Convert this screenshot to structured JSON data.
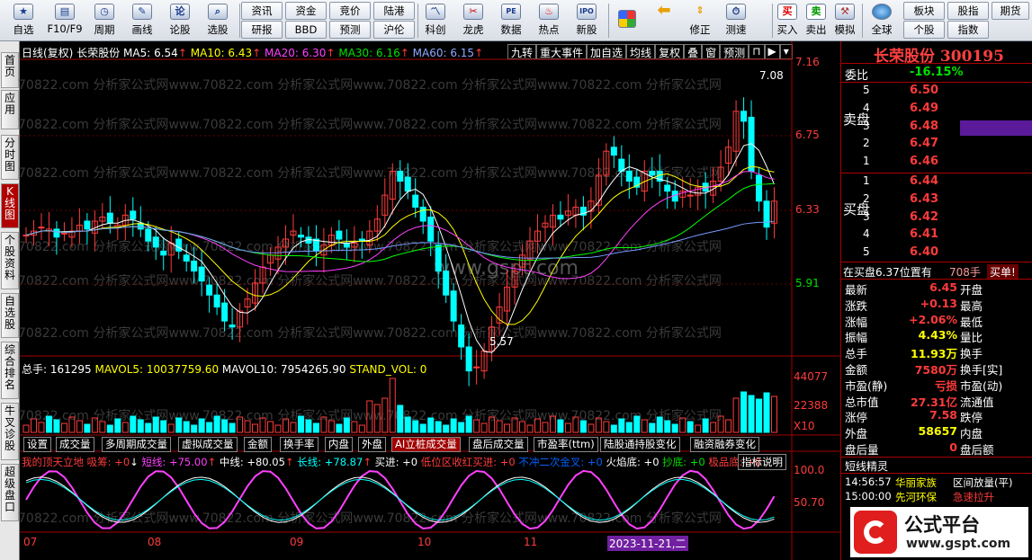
{
  "toolbar": {
    "buttons": [
      "自选",
      "F10/F9",
      "周期",
      "画线",
      "论股",
      "选股",
      "资讯",
      "资金",
      "竞价",
      "陆港",
      "研报",
      "BBD",
      "预测",
      "沪伦",
      "科创",
      "龙虎",
      "数据",
      "热点",
      "新股",
      "买入",
      "卖出",
      "模拟",
      "全球",
      "板块",
      "股指",
      "期货",
      "个股",
      "指数"
    ],
    "icons": [
      "star-icon",
      "f10-icon",
      "clock-icon",
      "pen-icon",
      "discuss-icon",
      "magnifier-icon",
      "news",
      "fund",
      "auction",
      "hk-connect",
      "report",
      "bbd",
      "forecast",
      "shanghai-london",
      "star-market-icon",
      "dragon-tiger-icon",
      "pe-data-icon",
      "hot-icon",
      "ipo-icon"
    ],
    "nav": [
      "修正",
      "测速"
    ]
  },
  "leftnav": [
    "首页",
    "应用",
    "分时图",
    "K线图",
    "个股资料",
    "自选股",
    "综合排名",
    "牛叉诊股",
    "超级盘口"
  ],
  "chart_header": {
    "period": "日线(复权)",
    "stock": "长荣股份",
    "ma5": "MA5: 6.54",
    "ma10": "MA10: 6.43",
    "ma20": "MA20: 6.30",
    "ma30": "MA30: 6.16",
    "ma60": "MA60: 6.15"
  },
  "chart_buttons": [
    "九转",
    "重大事件",
    "加自选",
    "均线",
    "复权",
    "叠",
    "窗",
    "预测"
  ],
  "price_axis": [
    "7.16",
    "6.75",
    "6.33",
    "5.91"
  ],
  "max_label": "7.08",
  "min_label": "5.57",
  "watermarks": {
    "text": "70822.com 分析家公式网www.70822.com 分析家公式网www.70822.com 分析家公式网www.70822.com 分析家公式网",
    "center": "www.gspt.com"
  },
  "volume_header": {
    "total": "总手: 161295",
    "mavol5": "MAVOL5: 10037759.60",
    "mavol10": "MAVOL10: 7954265.90",
    "stand": "STAND_VOL: 0"
  },
  "volume_axis": [
    "44077",
    "22388",
    "X10"
  ],
  "tabs": [
    "设置",
    "成交量",
    "多周期成交量",
    "虚拟成交量",
    "金额",
    "换手率",
    "内盘",
    "外盘",
    "AI立桩成交量",
    "盘后成交量",
    "市盈率(ttm)",
    "陆股通持股变化",
    "融资融券变化"
  ],
  "indicator_header": {
    "a": "我的顶天立地 吸筹: +0",
    "b": "短线: +75.00",
    "c": "中线: +80.05",
    "d": "长线: +78.87",
    "e": "买进: +0",
    "f": "低位区收红买进: +0",
    "g": "不冲二次金叉: +0",
    "h": "火焰底: +0",
    "i": "抄底: +0",
    "j": "极品底: +0",
    "btn": "指标说明"
  },
  "indicator_axis": [
    "100.0",
    "50.70"
  ],
  "date_axis": [
    "07",
    "08",
    "09",
    "10",
    "11"
  ],
  "cursor_date": "2023-11-21,二",
  "right": {
    "title": "长荣股份",
    "code": "300195",
    "weibi_label": "委比",
    "weibi": "-16.15%",
    "sell_label": "卖盘",
    "buy_label": "买盘",
    "sell": [
      {
        "n": "5",
        "p": "6.50"
      },
      {
        "n": "4",
        "p": "6.49"
      },
      {
        "n": "3",
        "p": "6.48"
      },
      {
        "n": "2",
        "p": "6.47"
      },
      {
        "n": "1",
        "p": "6.46"
      }
    ],
    "buy": [
      {
        "n": "1",
        "p": "6.44"
      },
      {
        "n": "2",
        "p": "6.43"
      },
      {
        "n": "3",
        "p": "6.42"
      },
      {
        "n": "4",
        "p": "6.41"
      },
      {
        "n": "5",
        "p": "6.40"
      }
    ],
    "tip": "在买盘6.37位置有",
    "tip_vol": "708手",
    "tip_action": "买单!",
    "quote": [
      {
        "l": "最新",
        "v": "6.45",
        "r": "开盘"
      },
      {
        "l": "涨跌",
        "v": "+0.13",
        "r": "最高"
      },
      {
        "l": "涨幅",
        "v": "+2.06%",
        "r": "最低"
      },
      {
        "l": "振幅",
        "v": "4.43%",
        "r": "量比"
      },
      {
        "l": "总手",
        "v": "11.93万",
        "r": "换手"
      },
      {
        "l": "金额",
        "v": "7580万",
        "r": "换手[实]"
      },
      {
        "l": "市盈(静)",
        "v": "亏损",
        "r": "市盈(动)"
      },
      {
        "l": "总市值",
        "v": "27.31亿",
        "r": "流通值"
      },
      {
        "l": "涨停",
        "v": "7.58",
        "r": "跌停"
      },
      {
        "l": "外盘",
        "v": "58657",
        "r": "内盘"
      },
      {
        "l": "盘后量",
        "v": "0",
        "r": "盘后额"
      }
    ],
    "elf_title": "短线精灵",
    "elf": [
      {
        "t": "14:56:57",
        "s": "华丽家族",
        "e": "区间放量(平)"
      },
      {
        "t": "15:00:00",
        "s": "先河环保",
        "e": "急速拉升"
      }
    ],
    "brand": "公式平台",
    "brand_url": "www.gspt.com"
  },
  "colors": {
    "up": "#ff3b3b",
    "down": "#00ffff",
    "ma5": "#ffffff",
    "ma10": "#ffff00",
    "ma20": "#ff40ff",
    "ma30": "#00ff00",
    "ma60": "#7799ff"
  }
}
